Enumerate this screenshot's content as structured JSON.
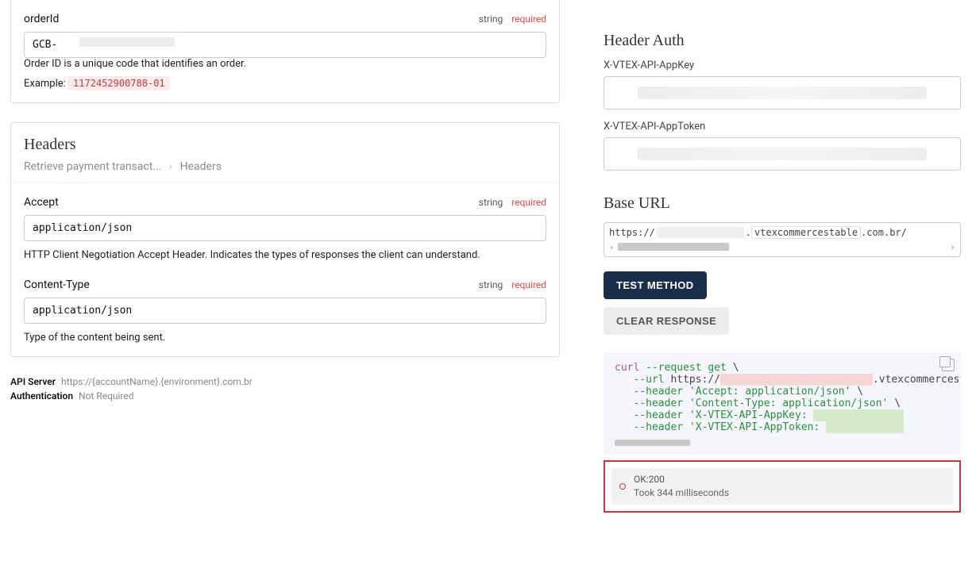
{
  "params": {
    "orderId": {
      "name": "orderId",
      "type": "string",
      "required": "required",
      "value": "GCB-",
      "description": "Order ID is a unique code that identifies an order.",
      "example_label": "Example:",
      "example_value": "1172452900788-01"
    }
  },
  "headers_panel": {
    "title": "Headers",
    "breadcrumb_a": "Retrieve payment transact...",
    "breadcrumb_sep": "›",
    "breadcrumb_b": "Headers",
    "accept": {
      "name": "Accept",
      "type": "string",
      "required": "required",
      "value": "application/json",
      "description": "HTTP Client Negotiation Accept Header. Indicates the types of responses the client can understand."
    },
    "content_type": {
      "name": "Content-Type",
      "type": "string",
      "required": "required",
      "value": "application/json",
      "description": "Type of the content being sent."
    }
  },
  "footer": {
    "api_server_label": "API Server",
    "api_server_value": "https://{accountName}.{environment}.com.br",
    "auth_label": "Authentication",
    "auth_value": "Not Required"
  },
  "sidebar": {
    "header_auth_title": "Header Auth",
    "appkey_label": "X-VTEX-API-AppKey",
    "apptoken_label": "X-VTEX-API-AppToken",
    "base_url_title": "Base URL",
    "url_part1": "https://",
    "url_part2": ".",
    "url_part3": "vtexcommercestable",
    "url_part4": ".com.br/",
    "test_button": "TEST METHOD",
    "clear_button": "CLEAR RESPONSE"
  },
  "curl": {
    "cmd": "curl",
    "flag_request": "--request",
    "method": "get",
    "flag_url": "--url",
    "url_prefix": "https://",
    "url_suffix": ".vtexcommercesta",
    "flag_header": "--header",
    "h_accept": "'Accept: application/json'",
    "h_ctype": "'Content-Type: application/json'",
    "h_appkey_prefix": "'X-VTEX-API-AppKey:",
    "h_apptoken_prefix": "'X-VTEX-API-AppToken:"
  },
  "response": {
    "status": "OK:200",
    "timing": "Took 344 milliseconds"
  }
}
